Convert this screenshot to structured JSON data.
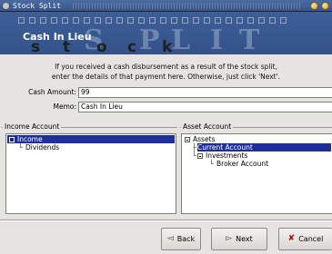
{
  "window": {
    "title": "Stock Split"
  },
  "banner": {
    "title": "Cash In Lieu",
    "watermark_word": "Stock"
  },
  "intro": {
    "line1": "If you received a cash disbursement as a result of the stock split,",
    "line2": "enter the details of that payment here. Otherwise, just click 'Next'."
  },
  "form": {
    "cash_amount_label": "Cash Amount:",
    "cash_amount_value": "99",
    "memo_label": "Memo:",
    "memo_value": "Cash In Lieu"
  },
  "income_account": {
    "frame_label": "Income Account",
    "tree": [
      {
        "label": "Income",
        "selected": true
      },
      {
        "label": "Dividends",
        "selected": false
      }
    ]
  },
  "asset_account": {
    "frame_label": "Asset Account",
    "tree": [
      {
        "label": "Assets",
        "selected": false
      },
      {
        "label": "Current Account",
        "selected": true
      },
      {
        "label": "Investments",
        "selected": false
      },
      {
        "label": "Broker Account",
        "selected": false
      }
    ]
  },
  "buttons": {
    "back": "Back",
    "next": "Next",
    "cancel": "Cancel"
  },
  "icons": {
    "app": "app-menu-icon",
    "back": "arrow-left-icon",
    "next": "arrow-right-icon",
    "cancel": "cancel-x-icon"
  },
  "colors": {
    "title_bar": "#4a6aa3",
    "banner": "#3d5f98",
    "selection": "#1f2f9a",
    "cancel_icon": "#b00000"
  }
}
